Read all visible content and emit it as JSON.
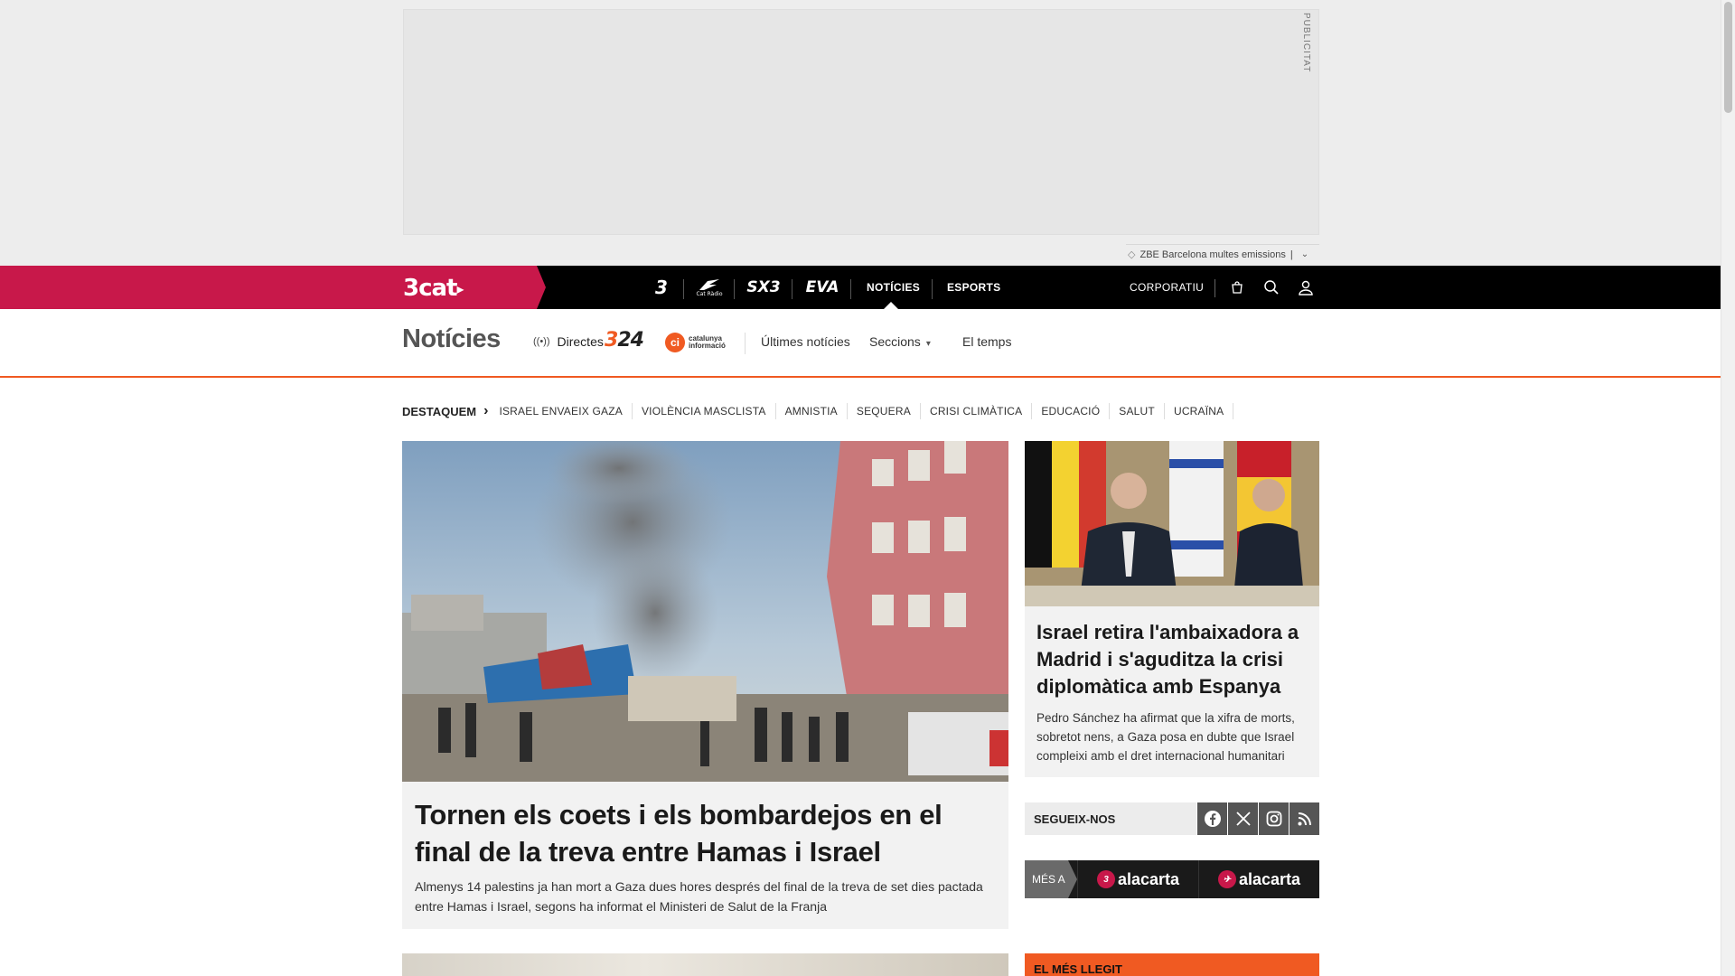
{
  "ad": {
    "label": "PUBLICITAT",
    "tag_text": "ZBE Barcelona multes emissions",
    "tag_sep": "|"
  },
  "topnav": {
    "brand": "3cat",
    "channels": [
      {
        "label": "3",
        "name": "tv3"
      },
      {
        "label": "Cat Ràdio",
        "name": "catradio"
      },
      {
        "label": "SX3",
        "name": "sx3"
      },
      {
        "label": "EVA",
        "name": "eva"
      }
    ],
    "links": [
      "NOTÍCIES",
      "ESPORTS"
    ],
    "active": "NOTÍCIES",
    "corporate": "CORPORATIU",
    "icons": [
      "shopping-bag-icon",
      "search-icon",
      "user-icon"
    ]
  },
  "section": {
    "title": "Notícies",
    "live_label": "Directes",
    "logo_324_a": "3",
    "logo_324_b": "24",
    "catinfo_line1": "catalunya",
    "catinfo_line2": "informació",
    "links": [
      "Últimes notícies",
      "Seccions",
      "El temps"
    ]
  },
  "tags": {
    "label": "DESTAQUEM",
    "items": [
      "ISRAEL ENVAEIX GAZA",
      "VIOLÈNCIA MASCLISTA",
      "AMNISTIA",
      "SEQUERA",
      "CRISI CLIMÀTICA",
      "EDUCACIÓ",
      "SALUT",
      "UCRAÏNA"
    ]
  },
  "main_article": {
    "title": "Tornen els coets i els bombardejos en el final de la treva entre Hamas i Israel",
    "summary": "Almenys 14 palestins ja han mort a Gaza dues hores després del final de la treva de set dies pactada entre Hamas i Israel, segons ha informat el Ministeri de Salut de la Franja"
  },
  "side_article": {
    "title": "Israel retira l'ambaixadora a Madrid i s'aguditza la crisi diplomàtica amb Espanya",
    "summary": "Pedro Sánchez ha afirmat que la xifra de morts, sobretot nens, a Gaza posa en dubte que Israel compleixi amb el dret internacional humanitari"
  },
  "follow": {
    "label": "SEGUEIX-NOS",
    "icons": [
      "facebook-icon",
      "x-icon",
      "instagram-icon",
      "rss-icon"
    ]
  },
  "more_at": {
    "label": "MÉS A",
    "items": [
      "alacarta",
      "alacarta"
    ]
  },
  "most_read": {
    "label": "EL MÉS LLEGIT"
  }
}
